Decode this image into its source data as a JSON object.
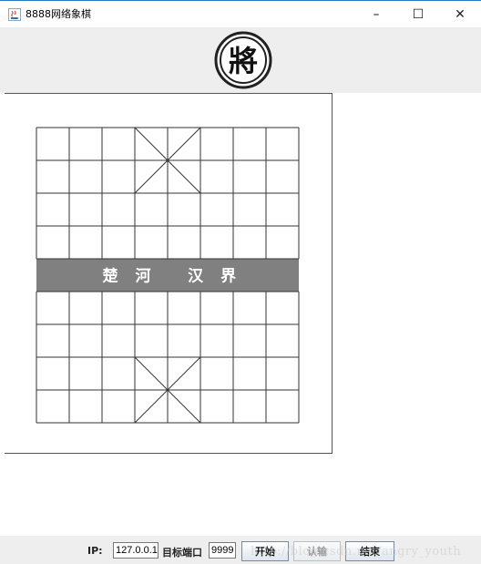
{
  "window": {
    "title": "8888网络象棋",
    "minimize_label": "–",
    "maximize_label": "☐",
    "close_label": "✕"
  },
  "header": {
    "piece_char": "將",
    "piece_icon": "general-piece-icon"
  },
  "board": {
    "river_chars": [
      "楚",
      "河",
      "汉",
      "界"
    ],
    "river_color": "#808080",
    "line_color": "#333333"
  },
  "bottom": {
    "ip_label": "IP:",
    "ip_value": "127.0.0.1",
    "port_label": "目标端口",
    "port_value": "9999",
    "start_label": "开始",
    "surrender_label": "认输",
    "end_label": "结束"
  },
  "watermark": "http://blog.csdn.net/angry_youth"
}
